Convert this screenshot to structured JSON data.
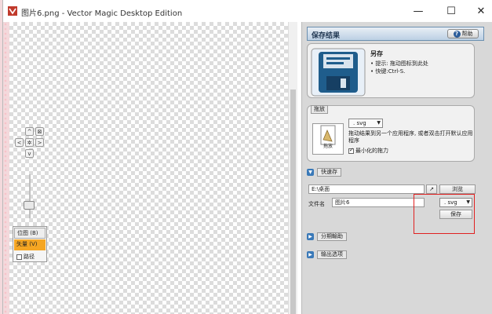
{
  "window": {
    "title": "图片6.png - Vector Magic Desktop Edition",
    "controls": {
      "minimize": "—",
      "maximize": "☐",
      "close": "✕"
    }
  },
  "nav": {
    "up": "^",
    "down": "v",
    "left": "<",
    "right": ">",
    "center": "✲",
    "fit": "⊠"
  },
  "modes": {
    "bitmap": "位图 (B)",
    "vector": "矢量 (V)",
    "path": "路径"
  },
  "panel": {
    "title": "保存结果",
    "help": "帮助",
    "saveas": {
      "title": "另存",
      "hint1": "• 提示: 拖动图标到此处",
      "hint2": "• 快键:Ctrl-S."
    },
    "drag": {
      "tab": "拖放",
      "icon_label": "拖放",
      "format": ". svg",
      "description": "拖动结果到另一个应用程序, 或者双击打开默认应用程序",
      "minimize_label": "最小化的拖力",
      "minimize_checked": true
    },
    "quick_save": {
      "label": "快速存",
      "path": "E:\\桌面",
      "browse": "浏览",
      "filename_label": "文件名",
      "filename": "图片6",
      "format": ". svg",
      "save": "保存"
    },
    "collapsed": {
      "sharing": "分期輸助",
      "output_options": "输出选项"
    }
  },
  "colors": {
    "accent": "#3a79b8",
    "highlight": "#f5a623",
    "annotation": "#e02020"
  }
}
